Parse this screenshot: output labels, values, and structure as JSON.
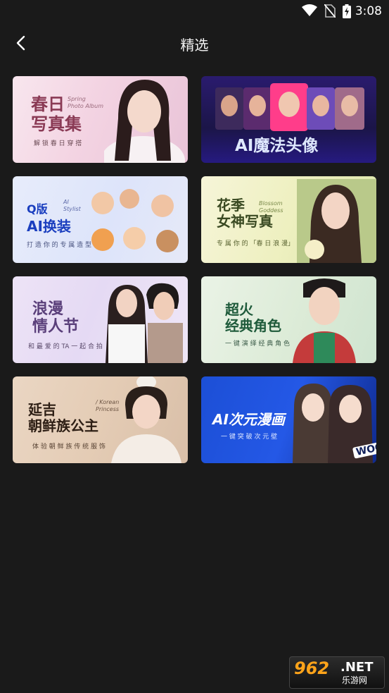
{
  "status_bar": {
    "time": "3:08",
    "icons": [
      "wifi-icon",
      "no-sim-icon",
      "battery-charging-icon"
    ]
  },
  "header": {
    "title": "精选",
    "back_icon": "chevron-left-icon"
  },
  "cards": [
    {
      "title": "春日\n写真集",
      "english": "Spring\nPhoto Album",
      "subtitle": "解 锁 春 日 穿 搭"
    },
    {
      "title": "AI魔法头像"
    },
    {
      "badge": "Q版",
      "title": "AI换装",
      "english": "AI\nStylist",
      "subtitle": "打 造 你 的 专 属 造 型"
    },
    {
      "title": "花季\n女神写真",
      "english": "Blossom\nGoddess",
      "subtitle": "专 属 你 的 「春 日 浪 漫」"
    },
    {
      "title": "浪漫\n情人节",
      "subtitle": "和 最 爱 的 TA 一 起 合 拍"
    },
    {
      "title": "超火\n经典角色",
      "subtitle": "一 键 演 绎 经 典 角 色"
    },
    {
      "title": "延吉\n朝鲜族公主",
      "english": "/ Korean\nPrincess",
      "subtitle": "体 验 朝 鲜 族 传 统 服 饰"
    },
    {
      "title": "AI次元漫画",
      "subtitle": "一 键 突 破 次 元 壁",
      "sticker": "WOO"
    }
  ],
  "watermark": {
    "text": "962",
    "suffix": ".NET",
    "caption": "乐游网"
  }
}
